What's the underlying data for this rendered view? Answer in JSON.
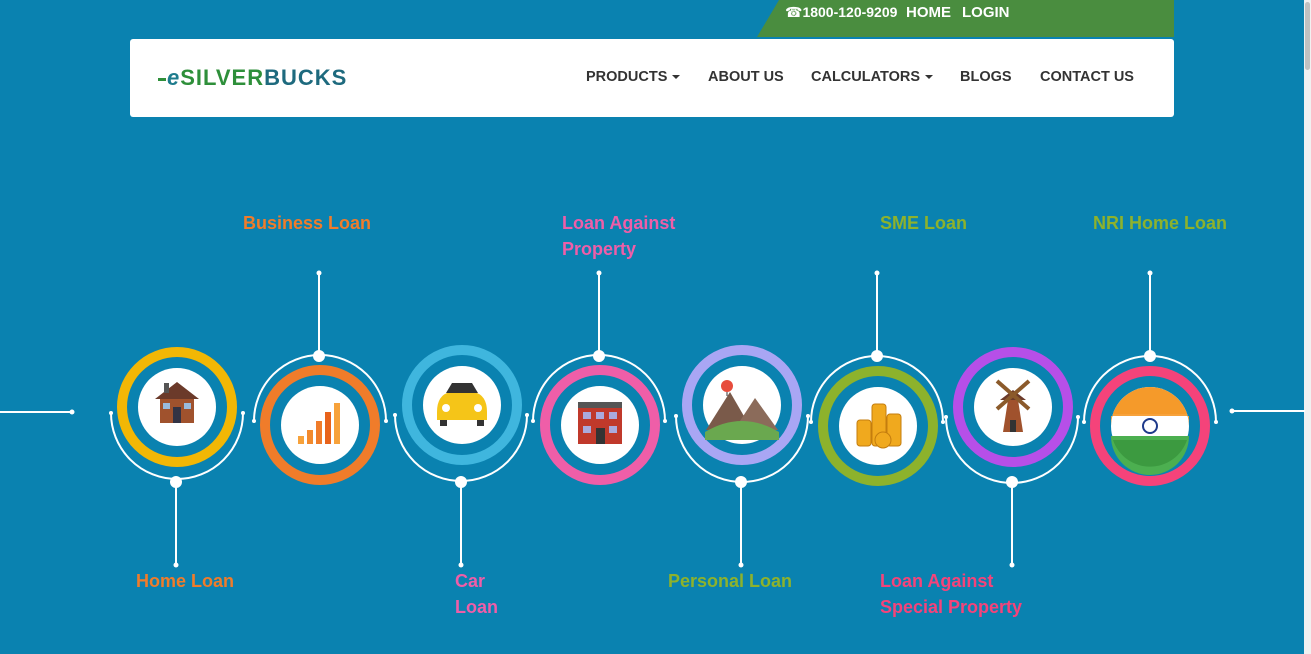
{
  "topbar": {
    "phone": "☎1800-120-9209",
    "home": "HOME",
    "login": "LOGIN"
  },
  "navbar": {
    "logo_e": "e",
    "logo_silver": "SILVER",
    "logo_bucks": "BUCKS",
    "items": [
      {
        "label": "PRODUCTS"
      },
      {
        "label": "ABOUT US"
      },
      {
        "label": "CALCULATORS"
      },
      {
        "label": "BLOGS"
      },
      {
        "label": "CONTACT US"
      }
    ]
  },
  "loans": {
    "home": "Home Loan",
    "business": "Business Loan",
    "car_line1": "Car",
    "car_line2": "Loan",
    "lap_line1": "Loan Against",
    "lap_line2": "Property",
    "personal": "Personal Loan",
    "sme": "SME Loan",
    "lasp_line1": "Loan Against",
    "lasp_line2": "Special Property",
    "nri": "NRI Home Loan"
  },
  "colors": {
    "background": "#0a82b0",
    "topbar": "#4a8d3f",
    "home": "#f2b705",
    "business": "#f07c2a",
    "car": "#3fb6de",
    "lap": "#ef5ea8",
    "personal": "#a9a6f4",
    "sme": "#8db22c",
    "lasp": "#b64fe8",
    "nri": "#f5437a"
  },
  "icons": [
    "house-icon",
    "bar-chart-icon",
    "car-icon",
    "building-icon",
    "mountain-balloon-icon",
    "coin-stacks-icon",
    "windmill-icon",
    "india-flag-icon"
  ]
}
